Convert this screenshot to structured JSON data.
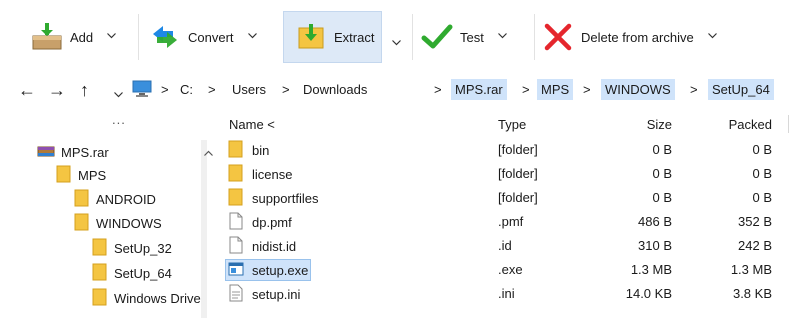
{
  "toolbar": {
    "add": {
      "label": "Add",
      "icon": "add-archive-icon"
    },
    "convert": {
      "label": "Convert",
      "icon": "convert-icon"
    },
    "extract": {
      "label": "Extract",
      "icon": "extract-icon"
    },
    "test": {
      "label": "Test",
      "icon": "test-checkmark-icon"
    },
    "delete": {
      "label": "Delete from archive",
      "icon": "delete-x-icon"
    }
  },
  "address": {
    "back": "←",
    "forward": "→",
    "up": "↑",
    "crumbs": [
      {
        "label": "C:",
        "highlighted": false
      },
      {
        "label": "Users",
        "highlighted": false
      },
      {
        "label": "Downloads",
        "highlighted": false
      },
      {
        "label": "MPS.rar",
        "highlighted": true
      },
      {
        "label": "MPS",
        "highlighted": true
      },
      {
        "label": "WINDOWS",
        "highlighted": true
      },
      {
        "label": "SetUp_64",
        "highlighted": true
      }
    ],
    "separator": ">"
  },
  "tree": {
    "more": "...",
    "items": [
      {
        "label": "MPS.rar",
        "icon": "archive-icon"
      },
      {
        "label": "MPS",
        "icon": "folder-icon"
      },
      {
        "label": "ANDROID",
        "icon": "folder-icon"
      },
      {
        "label": "WINDOWS",
        "icon": "folder-icon"
      },
      {
        "label": "SetUp_32",
        "icon": "folder-icon"
      },
      {
        "label": "SetUp_64",
        "icon": "folder-icon"
      },
      {
        "label": "Windows Drive",
        "icon": "folder-icon"
      }
    ]
  },
  "columns": {
    "name": "Name <",
    "type": "Type",
    "size": "Size",
    "packed": "Packed"
  },
  "files": [
    {
      "name": "bin",
      "type": "[folder]",
      "size": "0 B",
      "packed": "0 B",
      "icon": "folder-icon",
      "selected": false
    },
    {
      "name": "license",
      "type": "[folder]",
      "size": "0 B",
      "packed": "0 B",
      "icon": "folder-icon",
      "selected": false
    },
    {
      "name": "supportfiles",
      "type": "[folder]",
      "size": "0 B",
      "packed": "0 B",
      "icon": "folder-icon",
      "selected": false
    },
    {
      "name": "dp.pmf",
      "type": ".pmf",
      "size": "486 B",
      "packed": "352 B",
      "icon": "file-icon",
      "selected": false
    },
    {
      "name": "nidist.id",
      "type": ".id",
      "size": "310 B",
      "packed": "242 B",
      "icon": "file-icon",
      "selected": false
    },
    {
      "name": "setup.exe",
      "type": ".exe",
      "size": "1.3 MB",
      "packed": "1.3 MB",
      "icon": "exe-icon",
      "selected": true
    },
    {
      "name": "setup.ini",
      "type": ".ini",
      "size": "14.0 KB",
      "packed": "3.8 KB",
      "icon": "text-file-icon",
      "selected": false
    }
  ],
  "colors": {
    "folder": "#f4c542",
    "selection": "#cfe3fa",
    "check_green": "#2faa2f",
    "delete_red": "#e5262d"
  }
}
